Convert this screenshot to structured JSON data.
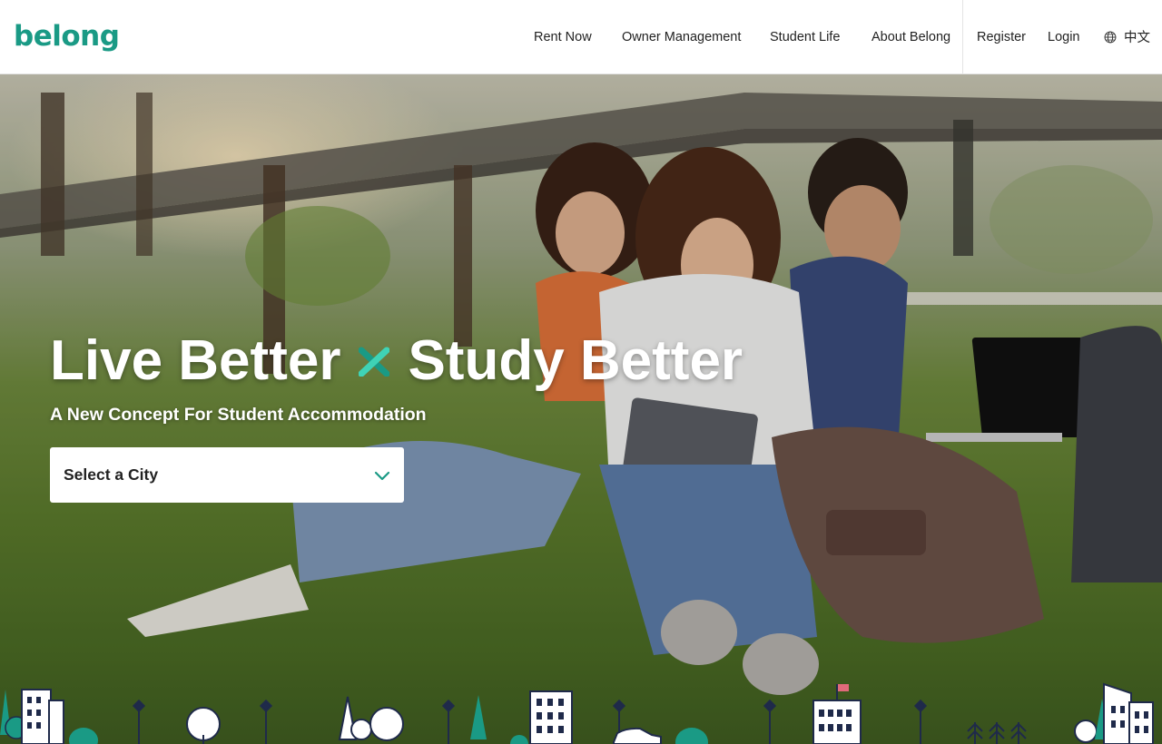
{
  "header": {
    "logo": "belong",
    "nav": [
      {
        "label": "Rent Now"
      },
      {
        "label": "Owner Management"
      },
      {
        "label": "Student Life"
      },
      {
        "label": "About Belong"
      }
    ],
    "register_label": "Register",
    "login_label": "Login",
    "language_label": "中文"
  },
  "hero": {
    "title_left": "Live Better",
    "title_right": "Study Better",
    "subtitle": "A New Concept For Student Accommodation",
    "city_select": {
      "selected": "Select a City"
    }
  },
  "colors": {
    "brand": "#1a9a85",
    "accent_x": "#2bc4a6",
    "skyline_teal": "#1a9a85",
    "skyline_navy": "#1f2a4a"
  },
  "icons": [
    "globe-icon",
    "chevron-down-icon",
    "x-mark-icon"
  ]
}
